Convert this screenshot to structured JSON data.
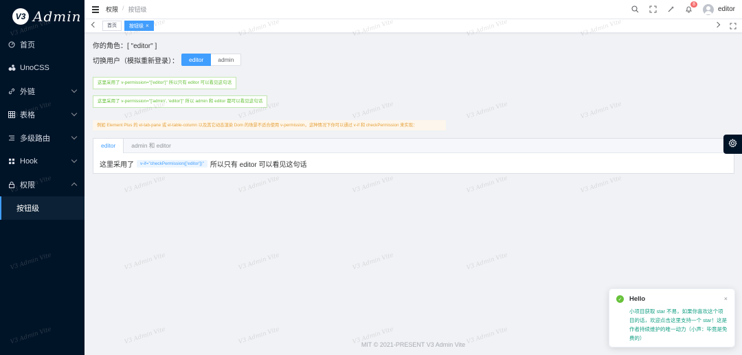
{
  "app": {
    "logo_badge": "V3",
    "logo_text": "Admin",
    "watermark": "V3 Admin Vite"
  },
  "sidebar": {
    "items": [
      {
        "label": "首页",
        "icon": "dashboard-icon"
      },
      {
        "label": "UnoCSS",
        "icon": "unocss-icon"
      },
      {
        "label": "外链",
        "icon": "link-icon"
      },
      {
        "label": "表格",
        "icon": "table-icon"
      },
      {
        "label": "多级路由",
        "icon": "menu-icon"
      },
      {
        "label": "Hook",
        "icon": "grid-icon"
      },
      {
        "label": "权限",
        "icon": "lock-icon"
      }
    ],
    "sub_item": "按钮级"
  },
  "header": {
    "breadcrumb": [
      "权限",
      "/",
      "按钮级"
    ],
    "notification_count": "8",
    "username": "editor"
  },
  "tags": [
    {
      "label": "首页",
      "active": false
    },
    {
      "label": "按钮级",
      "active": true,
      "close": "×"
    }
  ],
  "main": {
    "role_text": "你的角色：[ \"editor\" ]",
    "switch_label": "切换用户（模拟重新登录）：",
    "radio": [
      "editor",
      "admin"
    ],
    "alert1": "这里采用了 v-permission=\"['editor']\" 所以只有 editor 可以看见这句话",
    "alert2": "这里采用了 v-permission=\"['admin', 'editor']\" 所以 admin 和 editor 都可以看见这句话",
    "alert3": "例如 Element Plus 的 el-tab-pane 或 el-table-column 以及其它动态渲染 Dom 的场景不适合使用 v-permission，这种情况下你可以通过 v-if 和 checkPermission 来实现：",
    "tabs": [
      "editor",
      "admin 和 editor"
    ],
    "tab_text_before": "这里采用了",
    "tab_code": "v-if=\"checkPermission(['editor'])\"",
    "tab_text_after": "所以只有 editor 可以看见这句话"
  },
  "footer": "MIT © 2021-PRESENT V3 Admin Vite",
  "notification": {
    "title": "Hello",
    "close": "×",
    "message": "小项目获取 star 不易，如果你喜欢这个项目的话，欢迎点击这里支持一个 star！这是作者持续维护的唯一动力（小声：毕竟是免费的）"
  }
}
